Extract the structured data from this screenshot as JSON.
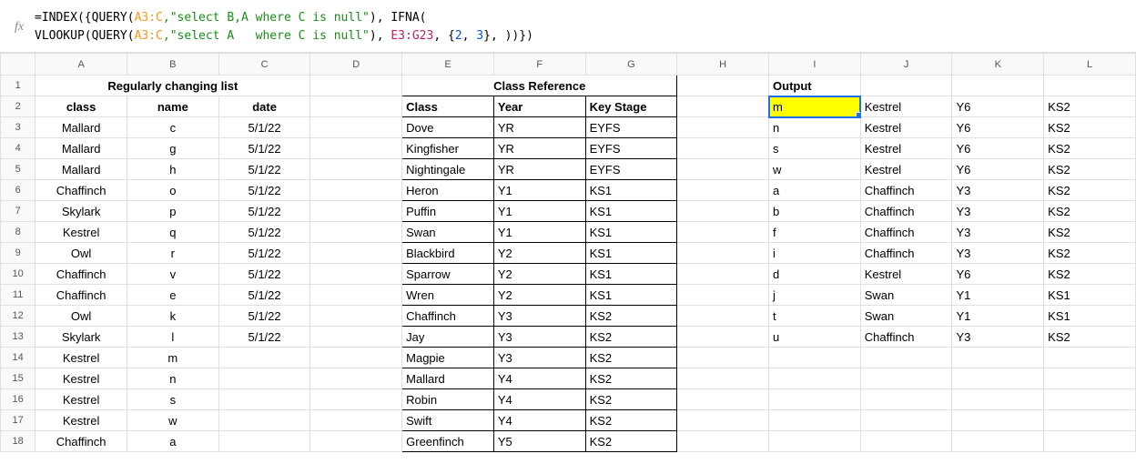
{
  "formula": {
    "line1_prefix": "=INDEX({QUERY(",
    "ref1": "A3:C",
    "str1": ",\"select B,A where C is null\"",
    "mid1": "), IFNA(",
    "line2_prefix": "VLOOKUP(QUERY(",
    "str2": ",\"select A   where C is null\"",
    "mid2": "), ",
    "ref2": "E3:G23",
    "mid3": ", {",
    "n2": "2",
    "mid4": ", ",
    "n3": "3",
    "suffix": "}, ))})"
  },
  "colHeaders": [
    "A",
    "B",
    "C",
    "D",
    "E",
    "F",
    "G",
    "H",
    "I",
    "J",
    "K",
    "L"
  ],
  "rowCount": 18,
  "merged": {
    "regularly": "Regularly changing list",
    "classRef": "Class Reference"
  },
  "hdr": {
    "class": "class",
    "name": "name",
    "date": "date",
    "Class": "Class",
    "Year": "Year",
    "KeyStage": "Key Stage",
    "Output": "Output"
  },
  "left": [
    {
      "class": "Mallard",
      "name": "c",
      "date": "5/1/22"
    },
    {
      "class": "Mallard",
      "name": "g",
      "date": "5/1/22"
    },
    {
      "class": "Mallard",
      "name": "h",
      "date": "5/1/22"
    },
    {
      "class": "Chaffinch",
      "name": "o",
      "date": "5/1/22"
    },
    {
      "class": "Skylark",
      "name": "p",
      "date": "5/1/22"
    },
    {
      "class": "Kestrel",
      "name": "q",
      "date": "5/1/22"
    },
    {
      "class": "Owl",
      "name": "r",
      "date": "5/1/22"
    },
    {
      "class": "Chaffinch",
      "name": "v",
      "date": "5/1/22"
    },
    {
      "class": "Chaffinch",
      "name": "e",
      "date": "5/1/22"
    },
    {
      "class": "Owl",
      "name": "k",
      "date": "5/1/22"
    },
    {
      "class": "Skylark",
      "name": "l",
      "date": "5/1/22"
    },
    {
      "class": "Kestrel",
      "name": "m",
      "date": ""
    },
    {
      "class": "Kestrel",
      "name": "n",
      "date": ""
    },
    {
      "class": "Kestrel",
      "name": "s",
      "date": ""
    },
    {
      "class": "Kestrel",
      "name": "w",
      "date": ""
    },
    {
      "class": "Chaffinch",
      "name": "a",
      "date": ""
    }
  ],
  "ref": [
    {
      "cls": "Dove",
      "yr": "YR",
      "ks": "EYFS"
    },
    {
      "cls": "Kingfisher",
      "yr": "YR",
      "ks": "EYFS"
    },
    {
      "cls": "Nightingale",
      "yr": "YR",
      "ks": "EYFS"
    },
    {
      "cls": "Heron",
      "yr": "Y1",
      "ks": "KS1"
    },
    {
      "cls": "Puffin",
      "yr": "Y1",
      "ks": "KS1"
    },
    {
      "cls": "Swan",
      "yr": "Y1",
      "ks": "KS1"
    },
    {
      "cls": "Blackbird",
      "yr": "Y2",
      "ks": "KS1"
    },
    {
      "cls": "Sparrow",
      "yr": "Y2",
      "ks": "KS1"
    },
    {
      "cls": "Wren",
      "yr": "Y2",
      "ks": "KS1"
    },
    {
      "cls": "Chaffinch",
      "yr": "Y3",
      "ks": "KS2"
    },
    {
      "cls": "Jay",
      "yr": "Y3",
      "ks": "KS2"
    },
    {
      "cls": "Magpie",
      "yr": "Y3",
      "ks": "KS2"
    },
    {
      "cls": "Mallard",
      "yr": "Y4",
      "ks": "KS2"
    },
    {
      "cls": "Robin",
      "yr": "Y4",
      "ks": "KS2"
    },
    {
      "cls": "Swift",
      "yr": "Y4",
      "ks": "KS2"
    },
    {
      "cls": "Greenfinch",
      "yr": "Y5",
      "ks": "KS2"
    }
  ],
  "output": [
    {
      "i": "m",
      "j": "Kestrel",
      "k": "Y6",
      "l": "KS2"
    },
    {
      "i": "n",
      "j": "Kestrel",
      "k": "Y6",
      "l": "KS2"
    },
    {
      "i": "s",
      "j": "Kestrel",
      "k": "Y6",
      "l": "KS2"
    },
    {
      "i": "w",
      "j": "Kestrel",
      "k": "Y6",
      "l": "KS2"
    },
    {
      "i": "a",
      "j": "Chaffinch",
      "k": "Y3",
      "l": "KS2"
    },
    {
      "i": "b",
      "j": "Chaffinch",
      "k": "Y3",
      "l": "KS2"
    },
    {
      "i": "f",
      "j": "Chaffinch",
      "k": "Y3",
      "l": "KS2"
    },
    {
      "i": "i",
      "j": "Chaffinch",
      "k": "Y3",
      "l": "KS2"
    },
    {
      "i": "d",
      "j": "Kestrel",
      "k": "Y6",
      "l": "KS2"
    },
    {
      "i": "j",
      "j": "Swan",
      "k": "Y1",
      "l": "KS1"
    },
    {
      "i": "t",
      "j": "Swan",
      "k": "Y1",
      "l": "KS1"
    },
    {
      "i": "u",
      "j": "Chaffinch",
      "k": "Y3",
      "l": "KS2"
    }
  ],
  "fx_label": "fx"
}
